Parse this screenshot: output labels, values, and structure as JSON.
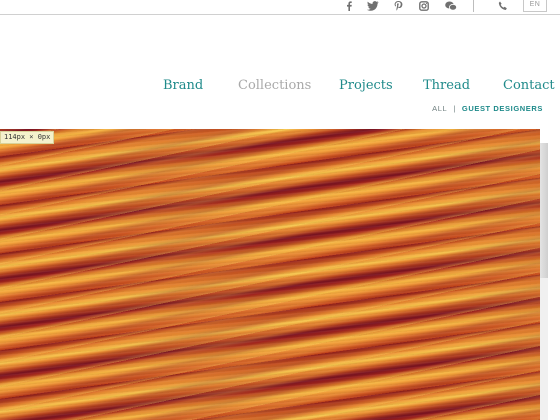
{
  "social": {
    "icons": [
      "facebook-icon",
      "twitter-icon",
      "pinterest-icon",
      "instagram-icon",
      "wechat-icon",
      "phone-icon"
    ]
  },
  "language": {
    "label": "EN"
  },
  "nav": {
    "items": [
      {
        "label": "Brand"
      },
      {
        "label": "Collections"
      },
      {
        "label": "Projects"
      },
      {
        "label": "Thread"
      },
      {
        "label": "Contact"
      }
    ]
  },
  "subnav": {
    "all": "ALL",
    "separator": "|",
    "guest": "GUEST DESIGNERS"
  },
  "debug": {
    "dimension": "114px × 0px"
  },
  "colors": {
    "accent": "#1f8a8a",
    "muted": "#a9a9a9"
  }
}
